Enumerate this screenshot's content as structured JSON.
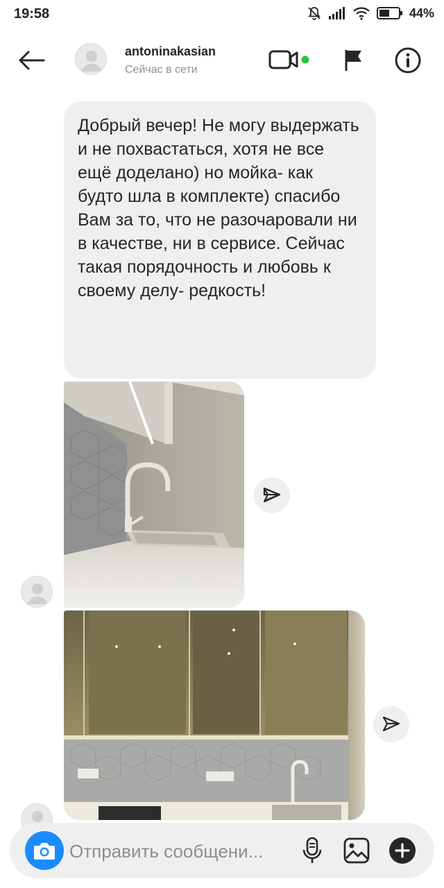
{
  "status_bar": {
    "time": "19:58",
    "battery_text": "44%",
    "icons": [
      "mute-bell-icon",
      "signal-icon",
      "wifi-icon",
      "battery-icon"
    ]
  },
  "header": {
    "back_icon": "back-arrow-icon",
    "username": "antoninakasian",
    "presence": "Сейчас в сети",
    "video_icon": "video-call-icon",
    "online_color": "#2bc341",
    "flag_icon": "flag-icon",
    "info_icon": "info-icon"
  },
  "messages": [
    {
      "type": "text",
      "text": "Добрый вечер! Не могу выдержать и не похвастаться, хотя не все ещё доделано) но мойка- как будто шла в комплекте) спасибо Вам за то, что не разочаровали ни в качестве, ни в сервисе. Сейчас такая порядочность и любовь к своему делу- редкость!"
    },
    {
      "type": "photo",
      "subject": "kitchen sink close-up"
    },
    {
      "type": "photo",
      "subject": "kitchen cabinets with hexagon backsplash"
    }
  ],
  "composer": {
    "placeholder": "Отправить сообщени...",
    "camera_icon": "camera-icon",
    "mic_icon": "microphone-icon",
    "gallery_icon": "gallery-icon",
    "plus_icon": "plus-icon",
    "accent_color": "#1a8cff"
  }
}
